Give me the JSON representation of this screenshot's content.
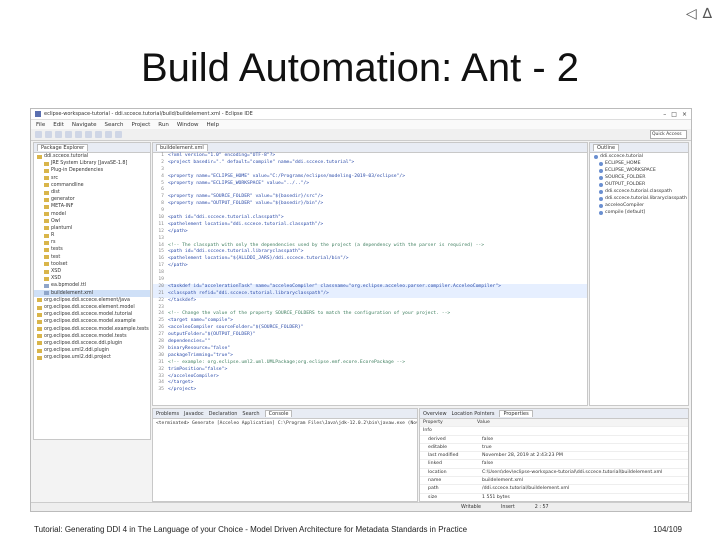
{
  "slide": {
    "title": "Build Automation: Ant - 2",
    "footer": "Tutorial: Generating DDI 4 in The Language of your Choice - Model Driven Architecture for Metadata Standards in Practice",
    "page": "104/109",
    "nav_prev": "◁",
    "nav_up": "∆"
  },
  "window": {
    "title": "eclipse-workspace-tutorial - ddi.sccece.tutorial/build/buildelement.xml - Eclipse IDE",
    "min": "–",
    "max": "□",
    "close": "×",
    "menu": [
      "File",
      "Edit",
      "Navigate",
      "Search",
      "Project",
      "Run",
      "Window",
      "Help"
    ],
    "quick_access": "Quick Access"
  },
  "explorer": {
    "tab": "Package Explorer",
    "items": [
      {
        "label": "ddi.sccece.tutorial",
        "file": false
      },
      {
        "label": "JRE System Library [JavaSE-1.8]",
        "file": false
      },
      {
        "label": "Plug-in Dependencies",
        "file": false
      },
      {
        "label": "src",
        "file": false
      },
      {
        "label": "commandline",
        "file": false
      },
      {
        "label": "dist",
        "file": false
      },
      {
        "label": "generator",
        "file": false
      },
      {
        "label": "META-INF",
        "file": false
      },
      {
        "label": "model",
        "file": false
      },
      {
        "label": "Owl",
        "file": false
      },
      {
        "label": "plantuml",
        "file": false
      },
      {
        "label": "R",
        "file": false
      },
      {
        "label": "rs",
        "file": false
      },
      {
        "label": "tests",
        "file": false
      },
      {
        "label": "test",
        "file": false
      },
      {
        "label": "toolset",
        "file": false
      },
      {
        "label": "XSD",
        "file": false
      },
      {
        "label": "XSD",
        "file": false
      },
      {
        "label": "ea.bpmodel.ttl",
        "file": true
      },
      {
        "label": "buildelement.xml",
        "file": true
      },
      {
        "label": "org.eclipse.ddi.sccece.element/java",
        "file": false
      },
      {
        "label": "org.eclipse.ddi.sccece.element.model",
        "file": false
      },
      {
        "label": "org.eclipse.ddi.sccece.model.tutorial",
        "file": false
      },
      {
        "label": "org.eclipse.ddi.sccece.model.example",
        "file": false
      },
      {
        "label": "org.eclipse.ddi.sccece.model.example.tests",
        "file": false
      },
      {
        "label": "org.eclipse.ddi.sccece.model.tests",
        "file": false
      },
      {
        "label": "org.eclipse.ddi.sccece.ddi.plugin",
        "file": false
      },
      {
        "label": "org.eclipse.uml2.ddi.plugin",
        "file": false
      },
      {
        "label": "org.eclipse.uml2.ddi.project",
        "file": false
      }
    ]
  },
  "editor": {
    "tab": "buildelement.xml",
    "lines": [
      {
        "n": "1",
        "t": "<?xml version=\"1.0\" encoding=\"UTF-8\"?>",
        "k": "code"
      },
      {
        "n": "2",
        "t": "<project basedir=\".\" default=\"compile\" name=\"ddi.sccece.tutorial\">",
        "k": "code"
      },
      {
        "n": "3",
        "t": "",
        "k": "code"
      },
      {
        "n": "4",
        "t": "  <property name=\"ECLIPSE_HOME\" value=\"C:/Programs/eclipse/modeling-2019-03/eclipse\"/>",
        "k": "code"
      },
      {
        "n": "5",
        "t": "  <property name=\"ECLIPSE_WORKSPACE\" value=\"../..\"/>",
        "k": "code"
      },
      {
        "n": "6",
        "t": "",
        "k": "code"
      },
      {
        "n": "7",
        "t": "  <property name=\"SOURCE_FOLDER\" value=\"${basedir}/src\"/>",
        "k": "code"
      },
      {
        "n": "8",
        "t": "  <property name=\"OUTPUT_FOLDER\" value=\"${basedir}/bin\"/>",
        "k": "code"
      },
      {
        "n": "9",
        "t": "",
        "k": "code"
      },
      {
        "n": "10",
        "t": "  <path id=\"ddi.sccece.tutorial.classpath\">",
        "k": "code"
      },
      {
        "n": "11",
        "t": "      <pathelement location=\"ddi.sccece.tutorial.classpath\"/>",
        "k": "code"
      },
      {
        "n": "12",
        "t": "  </path>",
        "k": "code"
      },
      {
        "n": "13",
        "t": "",
        "k": "code"
      },
      {
        "n": "14",
        "t": "  <!-- The classpath with only the dependencies used by the project (a dependency with the parser is required) -->",
        "k": "com"
      },
      {
        "n": "15",
        "t": "  <path id=\"ddi.sccece.tutorial.libraryclasspath\">",
        "k": "code"
      },
      {
        "n": "16",
        "t": "      <pathelement location=\"${ALLDDI_JARS}/ddi.sccece.tutorial/bin\"/>",
        "k": "code"
      },
      {
        "n": "17",
        "t": "  </path>",
        "k": "code"
      },
      {
        "n": "18",
        "t": "",
        "k": "code"
      },
      {
        "n": "19",
        "t": "",
        "k": "code"
      },
      {
        "n": "20",
        "t": "  <taskdef id=\"accelerationTask\" name=\"acceleoCompiler\" classname=\"org.eclipse.acceleo.parser.compiler.AcceleoCompiler\">",
        "k": "hl"
      },
      {
        "n": "21",
        "t": "      <classpath refid=\"ddi.sccece.tutorial.libraryclasspath\"/>",
        "k": "hl"
      },
      {
        "n": "22",
        "t": "  </taskdef>",
        "k": "code"
      },
      {
        "n": "23",
        "t": "",
        "k": "code"
      },
      {
        "n": "24",
        "t": "  <!-- Change the value of the property SOURCE_FOLDERS to match the configuration of your project. -->",
        "k": "com"
      },
      {
        "n": "25",
        "t": "  <target name=\"compile\">",
        "k": "code"
      },
      {
        "n": "26",
        "t": "      <acceleoCompiler sourceFolder=\"${SOURCE_FOLDER}\"",
        "k": "code"
      },
      {
        "n": "27",
        "t": "                       outputFolder=\"${OUTPUT_FOLDER}\"",
        "k": "code"
      },
      {
        "n": "28",
        "t": "                       dependencies=\"\"",
        "k": "code"
      },
      {
        "n": "29",
        "t": "                       binaryResource=\"false\"",
        "k": "code"
      },
      {
        "n": "30",
        "t": "                       packageTrimming=\"true\">",
        "k": "code"
      },
      {
        "n": "31",
        "t": "        <!-- example: org.eclipse.uml2.uml.UMLPackage;org.eclipse.emf.ecore.EcorePackage -->",
        "k": "com"
      },
      {
        "n": "32",
        "t": "                       trimPosition=\"false\">",
        "k": "code"
      },
      {
        "n": "33",
        "t": "      </acceleoCompiler>",
        "k": "code"
      },
      {
        "n": "34",
        "t": "  </target>",
        "k": "code"
      },
      {
        "n": "35",
        "t": "</project>",
        "k": "code"
      }
    ]
  },
  "outline": {
    "tab": "Outline",
    "items": [
      "ddi.sccece.tutorial",
      "ECLIPSE_HOME",
      "ECLIPSE_WORKSPACE",
      "SOURCE_FOLDER",
      "OUTPUT_FOLDER",
      "ddi.sccece.tutorial.classpath",
      "ddi.sccece.tutorial.libraryclasspath",
      "acceleoCompiler",
      "compile [default]"
    ]
  },
  "bottom_left": {
    "tabs": [
      "Problems",
      "Javadoc",
      "Declaration",
      "Search",
      "Console"
    ],
    "active_tab": "Console",
    "console_text": "<terminated> Generate [Acceleo Application] C:\\Program Files\\Java\\jdk-12.0.2\\bin\\javaw.exe (Nov 28, 2019, 2:33:19 PM)"
  },
  "properties": {
    "tabs": [
      "Overview",
      "Location Pointers",
      "Properties"
    ],
    "active_tab": "Properties",
    "header": [
      "Property",
      "Value"
    ],
    "section": "Info",
    "rows": [
      {
        "k": "derived",
        "v": "false"
      },
      {
        "k": "editable",
        "v": "true"
      },
      {
        "k": "last modified",
        "v": "November 28, 2019 at 2:43:23 PM"
      },
      {
        "k": "linked",
        "v": "false"
      },
      {
        "k": "location",
        "v": "C:\\Users\\dev\\eclipse-workspace-tutorial\\ddi.sccece.tutorial\\buildelement.xml"
      },
      {
        "k": "name",
        "v": "buildelement.xml"
      },
      {
        "k": "path",
        "v": "/ddi.sccece.tutorial/buildelement.xml"
      },
      {
        "k": "size",
        "v": "1 551 bytes"
      }
    ]
  },
  "status": {
    "mode": "Writable",
    "insert": "Insert",
    "pos": "2 : 57"
  }
}
